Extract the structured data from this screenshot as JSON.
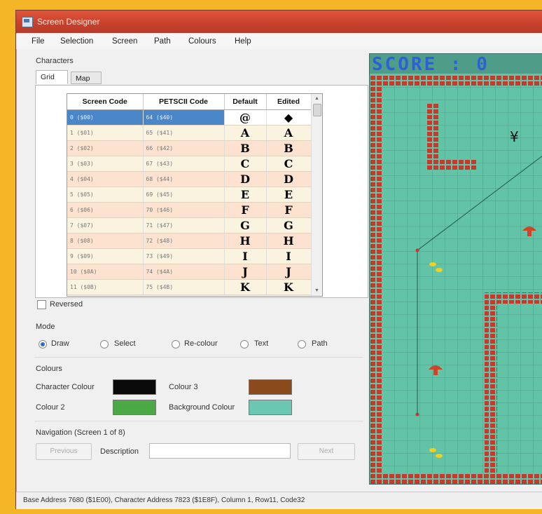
{
  "window": {
    "title": "Screen Designer"
  },
  "menu": [
    "File",
    "Selection",
    "Screen",
    "Path",
    "Colours",
    "Help"
  ],
  "characters": {
    "section_label": "Characters",
    "tabs": [
      "Grid",
      "Map"
    ],
    "columns": [
      "Screen Code",
      "PETSCII Code",
      "Default",
      "Edited"
    ],
    "rows": [
      {
        "screen": "0 ($00)",
        "petscii": "64 ($40)",
        "def": "@",
        "edit": "◆"
      },
      {
        "screen": "1 ($01)",
        "petscii": "65 ($41)",
        "def": "A",
        "edit": "A"
      },
      {
        "screen": "2 ($02)",
        "petscii": "66 ($42)",
        "def": "B",
        "edit": "B"
      },
      {
        "screen": "3 ($03)",
        "petscii": "67 ($43)",
        "def": "C",
        "edit": "C"
      },
      {
        "screen": "4 ($04)",
        "petscii": "68 ($44)",
        "def": "D",
        "edit": "D"
      },
      {
        "screen": "5 ($05)",
        "petscii": "69 ($45)",
        "def": "E",
        "edit": "E"
      },
      {
        "screen": "6 ($06)",
        "petscii": "70 ($46)",
        "def": "F",
        "edit": "F"
      },
      {
        "screen": "7 ($07)",
        "petscii": "71 ($47)",
        "def": "G",
        "edit": "G"
      },
      {
        "screen": "8 ($08)",
        "petscii": "72 ($48)",
        "def": "H",
        "edit": "H"
      },
      {
        "screen": "9 ($09)",
        "petscii": "73 ($49)",
        "def": "I",
        "edit": "I"
      },
      {
        "screen": "10 ($0A)",
        "petscii": "74 ($4A)",
        "def": "J",
        "edit": "J"
      },
      {
        "screen": "11 ($0B)",
        "petscii": "75 ($4B)",
        "def": "K",
        "edit": "K"
      }
    ],
    "selected_row": 0
  },
  "reversed_label": "Reversed",
  "mode": {
    "label": "Mode",
    "options": [
      "Draw",
      "Select",
      "Re-colour",
      "Text",
      "Path"
    ],
    "selected": "Draw"
  },
  "colours": {
    "label": "Colours",
    "character_colour_label": "Character Colour",
    "colour2_label": "Colour 2",
    "colour3_label": "Colour 3",
    "background_colour_label": "Background Colour",
    "character_colour": "#0a0a0a",
    "colour2": "#4aa845",
    "colour3": "#8a4a1c",
    "background_colour": "#6cc7b2"
  },
  "navigation": {
    "label": "Navigation (Screen 1 of 8)",
    "previous": "Previous",
    "description_label": "Description",
    "description_value": "",
    "next": "Next"
  },
  "status": "Base Address 7680 ($1E00), Character Address 7823 ($1E8F), Column 1, Row11, Code32",
  "game": {
    "score_text": "SCORE : 0"
  }
}
